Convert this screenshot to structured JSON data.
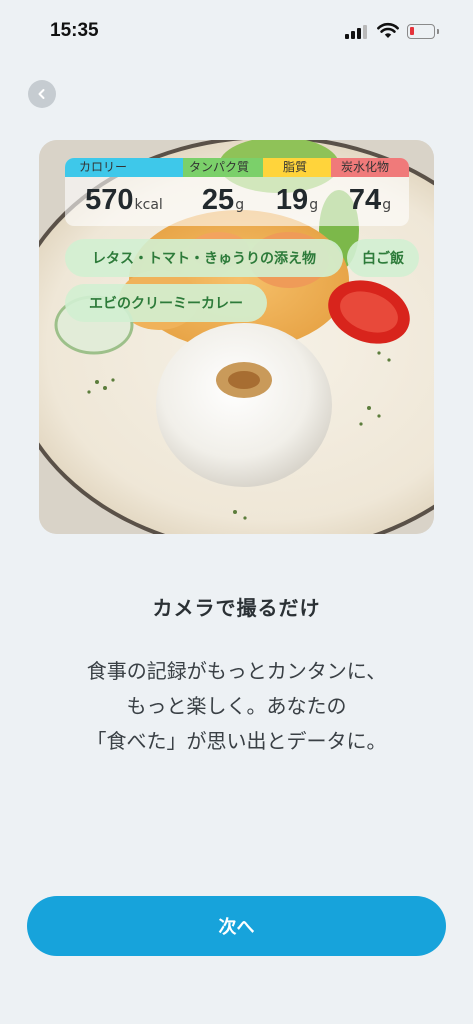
{
  "status_bar": {
    "time": "15:35"
  },
  "colors": {
    "accent": "#17a3db",
    "calorie": "#3ec8ea",
    "protein": "#7bd06a",
    "fat": "#ffd43b",
    "carb": "#f07a7a",
    "tag_text": "#2d7b3a"
  },
  "nutrition": [
    {
      "label": "カロリー",
      "value": "570",
      "unit": "kcal",
      "color": "#3ec8ea"
    },
    {
      "label": "タンパク質",
      "value": "25",
      "unit": "g",
      "color": "#7bd06a"
    },
    {
      "label": "脂質",
      "value": "19",
      "unit": "g",
      "color": "#ffd43b"
    },
    {
      "label": "炭水化物",
      "value": "74",
      "unit": "g",
      "color": "#f07a7a"
    }
  ],
  "food_tags": [
    "レタス・トマト・きゅうりの添え物",
    "白ご飯",
    "エビのクリーミーカレー"
  ],
  "heading": "カメラで撮るだけ",
  "body_lines": [
    "食事の記録がもっとカンタンに、",
    "もっと楽しく。あなたの",
    "「食べた」が思い出とデータに。"
  ],
  "next_button": "次へ",
  "icons": {
    "back": "chevron-left-icon",
    "signal": "cellular-signal-icon",
    "wifi": "wifi-icon",
    "battery": "battery-low-icon"
  }
}
